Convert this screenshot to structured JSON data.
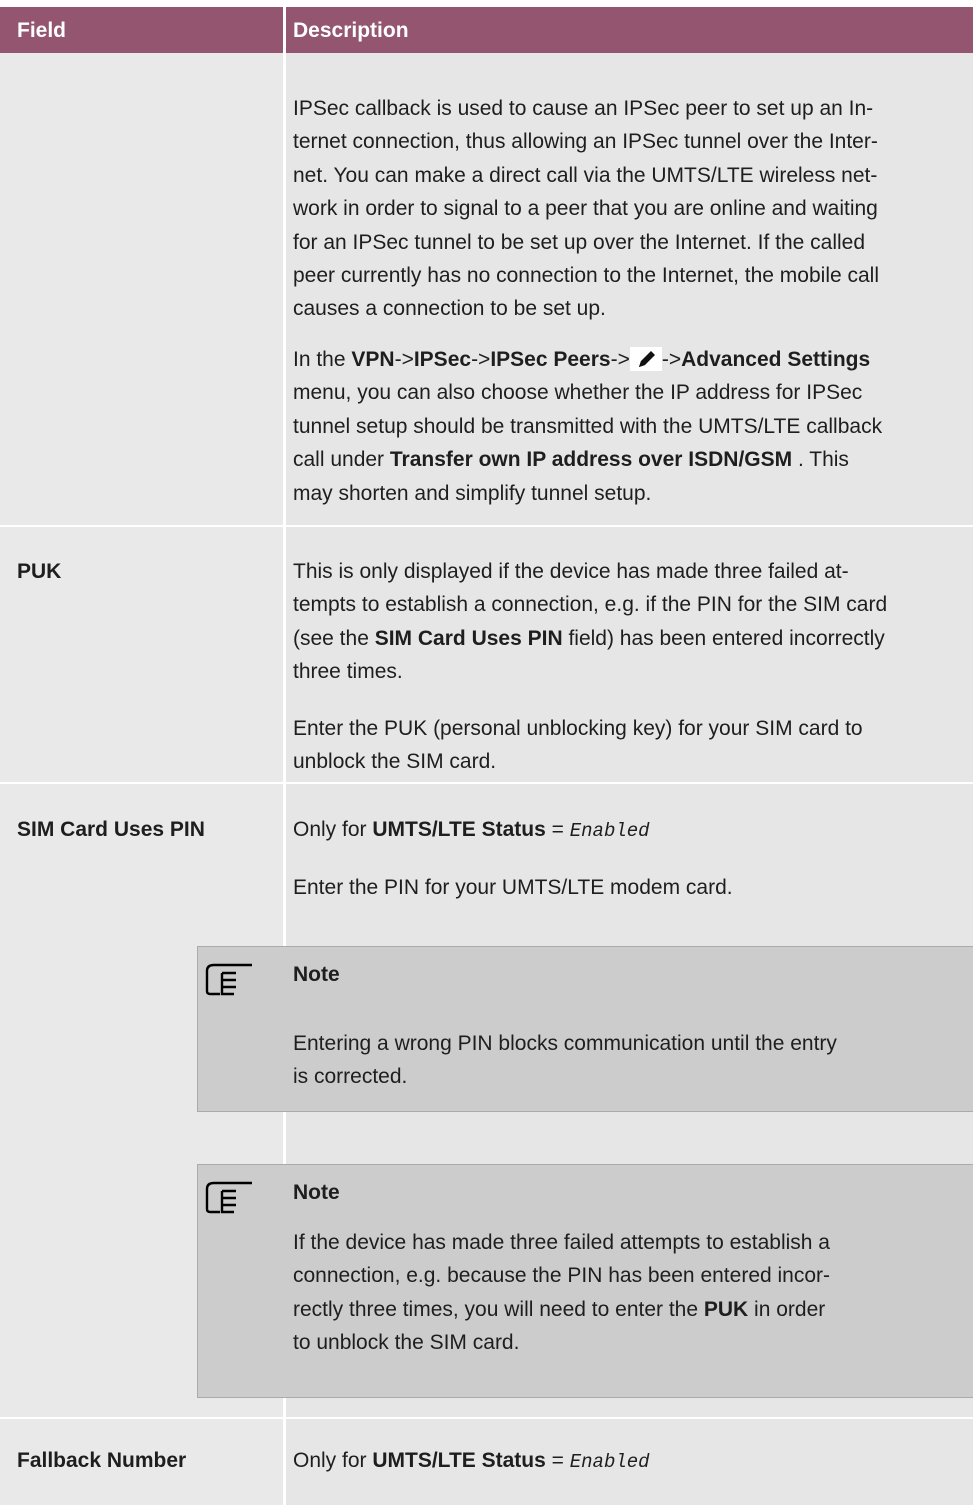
{
  "header": {
    "field": "Field",
    "description": "Description"
  },
  "callback_row": {
    "lines": [
      "IPSec callback is used to cause an IPSec peer to set up an In-",
      "ternet connection, thus allowing an IPSec tunnel over the Inter-",
      "net. You can make a direct call via the UMTS/LTE wireless net-",
      "work in order to signal to a peer that you are online and waiting",
      "for an IPSec tunnel to be set up over the Internet. If the called",
      "peer currently has no connection to the Internet, the mobile call",
      "causes a connection to be set up."
    ],
    "p2_prefix": "In the ",
    "p2_vpn": "VPN",
    "p2_arrow": "->",
    "p2_ipsec": "IPSec",
    "p2_peers": "IPSec Peers",
    "p2_adv": "Advanced Settings",
    "p2_line2": "menu, you can also choose whether the IP address for IPSec",
    "p2_line3": "tunnel setup should be transmitted with the UMTS/LTE callback",
    "p2_line4_a": "call under ",
    "p2_line4_b": "Transfer own IP address over ISDN/GSM",
    "p2_line4_c": " . This",
    "p2_line5": "may shorten and simplify tunnel setup."
  },
  "puk_row": {
    "field": "PUK",
    "l1": "This is only displayed if the device has made three failed at-",
    "l2": "tempts to establish a connection, e.g. if the PIN for the SIM card",
    "l3_a": "(see the ",
    "l3_b": "SIM Card Uses PIN",
    "l3_c": " field) has been entered incorrectly",
    "l4": "three times.",
    "l5": "Enter the PUK (personal unblocking key) for your SIM card to",
    "l6": "unblock the SIM card."
  },
  "pin_row": {
    "field": "SIM Card Uses PIN",
    "only_for": "Only for ",
    "status_label": "UMTS/LTE Status",
    "equals": " = ",
    "status_value": "Enabled",
    "text": "Enter the PIN for your UMTS/LTE modem card."
  },
  "note1": {
    "title": "Note",
    "l1": "Entering a wrong PIN blocks communication until the entry",
    "l2": "is corrected."
  },
  "note2": {
    "title": "Note",
    "l1": "If the device has made three failed attempts to establish a",
    "l2": "connection, e.g. because the PIN has been entered incor-",
    "l3_a": "rectly three times, you will need to enter the ",
    "l3_b": "PUK",
    "l3_c": " in order",
    "l4": "to unblock the SIM card."
  },
  "fallback_row": {
    "field": "Fallback Number",
    "only_for": "Only for ",
    "status_label": "UMTS/LTE Status",
    "equals": " = ",
    "status_value": "Enabled"
  }
}
